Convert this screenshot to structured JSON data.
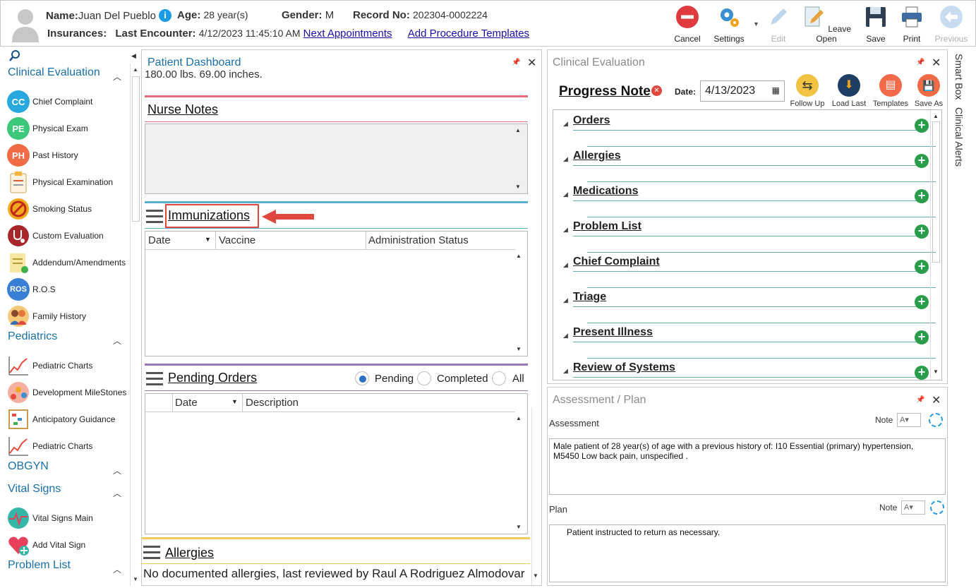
{
  "header": {
    "name_label": "Name:",
    "name": "Juan Del Pueblo",
    "info": "i",
    "age_label": "Age:",
    "age": "28 year(s)",
    "gender_label": "Gender:",
    "gender": "M",
    "record_label": "Record No:",
    "record": "202304-0002224",
    "insurances_label": "Insurances:",
    "last_encounter_label": "Last Encounter:",
    "last_encounter": "4/12/2023 11:45:10 AM",
    "next_appointments": "Next Appointments",
    "add_procedure_templates": "Add Procedure Templates"
  },
  "toolbar": {
    "cancel": "Cancel",
    "settings": "Settings",
    "edit": "Edit",
    "leave_open": "Leave Open",
    "save": "Save",
    "print": "Print",
    "previous": "Previous"
  },
  "sidebar": {
    "sections": {
      "clinical": "Clinical Evaluation",
      "pediatrics": "Pediatrics",
      "obgyn": "OBGYN",
      "vitals": "Vital Signs",
      "problem": "Problem List"
    },
    "items": [
      {
        "label": "Chief Complaint",
        "abbr": "CC",
        "color": "#29a8df"
      },
      {
        "label": "Physical Exam",
        "abbr": "PE",
        "color": "#3cc87a"
      },
      {
        "label": "Past History",
        "abbr": "PH",
        "color": "#f06b45"
      },
      {
        "label": "Physical Examination",
        "abbr": "",
        "color": "#f2b53a"
      },
      {
        "label": "Smoking Status",
        "abbr": "",
        "color": "#e8a020"
      },
      {
        "label": "Custom Evaluation",
        "abbr": "",
        "color": "#b02a2a"
      },
      {
        "label": "Addendum/Amendments",
        "abbr": "",
        "color": "#f3d35c"
      },
      {
        "label": "R.O.S",
        "abbr": "ROS",
        "color": "#3a7fd6"
      },
      {
        "label": "Family History",
        "abbr": "",
        "color": "#e98a4a"
      },
      {
        "label": "Pediatric Charts",
        "abbr": "",
        "color": "#e84c3d"
      },
      {
        "label": "Development MileStones",
        "abbr": "",
        "color": "#e97a5a"
      },
      {
        "label": "Anticipatory Guidance",
        "abbr": "",
        "color": "#e7b04a"
      },
      {
        "label": "Pediatric Charts",
        "abbr": "",
        "color": "#e84c3d"
      },
      {
        "label": "Vital Signs Main",
        "abbr": "",
        "color": "#35b7a8"
      },
      {
        "label": "Add Vital Sign",
        "abbr": "",
        "color": "#e8405a"
      }
    ]
  },
  "dashboard": {
    "title": "Patient Dashboard",
    "top_text": "180.00 lbs. 69.00 inches.",
    "nurse_notes": "Nurse Notes",
    "immunizations": "Immunizations",
    "imm_cols": [
      "Date",
      "Vaccine",
      "Administration Status"
    ],
    "pending_orders": "Pending Orders",
    "radio_pending": "Pending",
    "radio_completed": "Completed",
    "radio_all": "All",
    "po_cols": [
      "Date",
      "Description"
    ],
    "allergies": "Allergies",
    "allergies_text": "No documented allergies, last reviewed by Raul A Rodriguez Almodovar"
  },
  "clinical_eval": {
    "title": "Clinical Evaluation",
    "progress_note": "Progress Note",
    "date_label": "Date:",
    "date_value": "4/13/2023",
    "tools": [
      "Follow Up",
      "Load Last",
      "Templates",
      "Save As"
    ],
    "sections": [
      "Orders",
      "Allergies",
      "Medications",
      "Problem List",
      "Chief Complaint",
      "Triage",
      "Present Illness",
      "Review of Systems"
    ]
  },
  "assessment_plan": {
    "title": "Assessment / Plan",
    "assessment_label": "Assessment",
    "note_label": "Note",
    "assessment_text": "Male patient of 28 year(s) of age  with a previous history of: I10 Essential (primary) hypertension, M5450 Low back pain, unspecified .",
    "plan_label": "Plan",
    "plan_text": "Patient instructed to return as necessary."
  },
  "side_tabs": {
    "smart_box": "Smart Box",
    "clinical_alerts": "Clinical Alerts"
  },
  "colors": {
    "accent_blue": "#1a6fa8",
    "link": "#1a0dab",
    "add_green": "#2a9d4a",
    "highlight_red": "#e0473e"
  }
}
